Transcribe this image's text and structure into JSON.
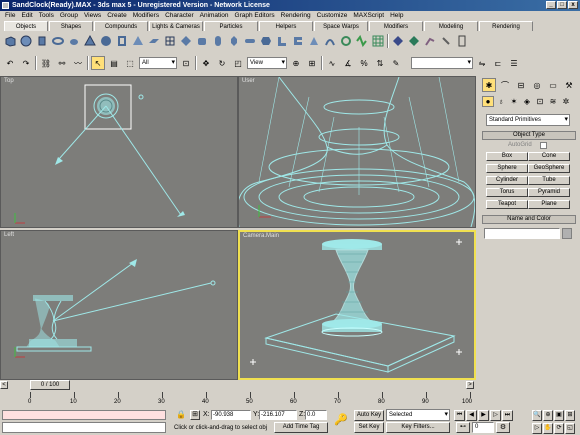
{
  "window": {
    "title": "SandClock(Ready).MAX - 3ds max 5 - Unregistered Version - Network License",
    "minimize": "_",
    "maximize": "□",
    "close": "x"
  },
  "menu": [
    "File",
    "Edit",
    "Tools",
    "Group",
    "Views",
    "Create",
    "Modifiers",
    "Character",
    "Animation",
    "Graph Editors",
    "Rendering",
    "Customize",
    "MAXScript",
    "Help"
  ],
  "tabs": [
    "Objects",
    "Shapes",
    "Compounds",
    "Lights & Cameras",
    "Particles",
    "Helpers",
    "Space Warps",
    "Modifiers",
    "Modeling",
    "Rendering"
  ],
  "toolbar2": {
    "selection_filter": "All",
    "reference_coord": "View"
  },
  "viewports": {
    "top": "Top",
    "user": "User",
    "left": "Left",
    "camera": "Camera.Main"
  },
  "command_panel": {
    "category": "Standard Primitives",
    "object_type_header": "Object Type",
    "autogrid": "AutoGrid",
    "primitives": [
      "Box",
      "Cone",
      "Sphere",
      "GeoSphere",
      "Cylinder",
      "Tube",
      "Torus",
      "Pyramid",
      "Teapot",
      "Plane"
    ],
    "name_color_header": "Name and Color"
  },
  "timeline": {
    "frame_counter": "0 / 100",
    "ruler_labels": [
      "0",
      "10",
      "20",
      "30",
      "40",
      "50",
      "60",
      "70",
      "80",
      "90",
      "100"
    ]
  },
  "status": {
    "x_label": "X:",
    "x_value": "-90.938",
    "y_label": "Y:",
    "y_value": "-216.107",
    "z_label": "Z:",
    "z_value": "0.0",
    "prompt": "Click or click-and-drag to select obj",
    "add_time_tag": "Add Time Tag",
    "auto_key": "Auto Key",
    "set_key": "Set Key",
    "key_mode": "Selected",
    "key_filters": "Key Filters...",
    "current_frame": "0"
  },
  "colors": {
    "wire": "#9fe8e8",
    "viewport_bg": "#7d7d7a",
    "active_border": "#f0e050",
    "title_bar": "#0a246a"
  }
}
